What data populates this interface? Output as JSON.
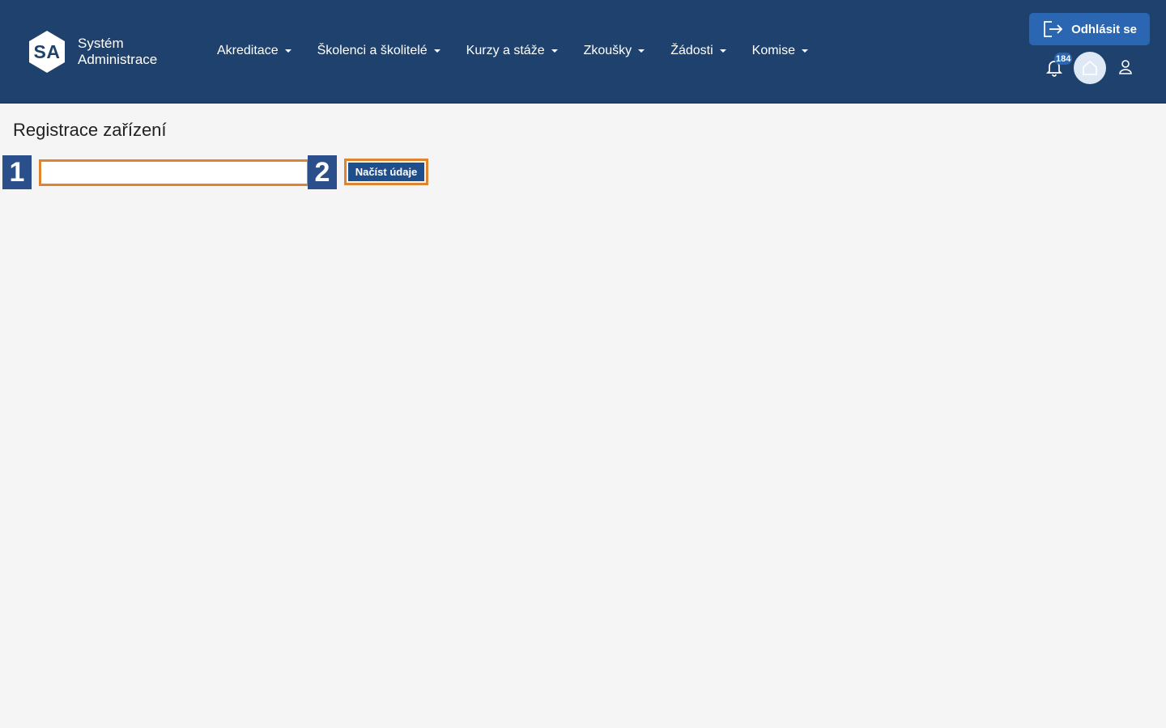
{
  "brand": {
    "logo_text": "SA",
    "line1": "Systém",
    "line2": "Administrace"
  },
  "nav": {
    "items": [
      {
        "label": "Akreditace"
      },
      {
        "label": "Školenci a školitelé"
      },
      {
        "label": "Kurzy a stáže"
      },
      {
        "label": "Zkoušky"
      },
      {
        "label": "Žádosti"
      },
      {
        "label": "Komise"
      }
    ]
  },
  "header_actions": {
    "logout_label": "Odhlásit se",
    "notifications_count": "184"
  },
  "page": {
    "title": "Registrace zařízení"
  },
  "form": {
    "input_value": "",
    "button_label": "Načíst údaje"
  },
  "markers": {
    "m1": "1",
    "m2": "2"
  },
  "colors": {
    "header_bg": "#1e426d",
    "accent": "#2a66b1",
    "highlight": "#e0852f",
    "marker_bg": "#2a4f8a"
  }
}
